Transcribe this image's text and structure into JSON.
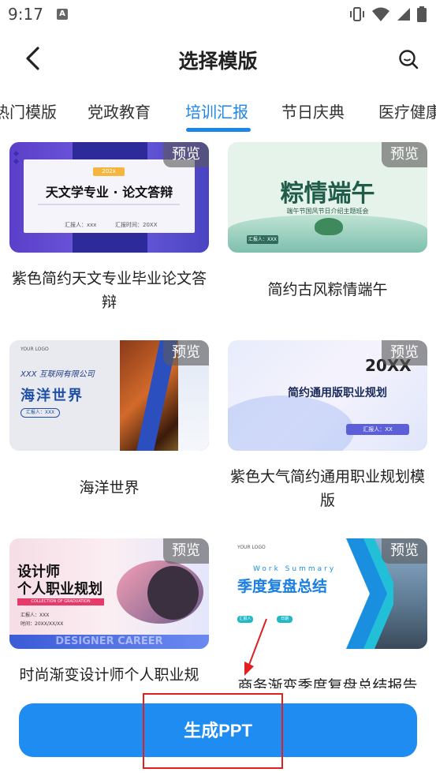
{
  "status": {
    "time": "9:17",
    "notif_letter": "A"
  },
  "header": {
    "title": "选择模版"
  },
  "tabs": [
    {
      "label": "热门模版"
    },
    {
      "label": "党政教育"
    },
    {
      "label": "培训汇报",
      "active": true
    },
    {
      "label": "节日庆典"
    },
    {
      "label": "医疗健康"
    }
  ],
  "templates": [
    {
      "name": "紫色简约天文专业毕业论文答辩",
      "thumb_title": "天文学专业 · 论文答辩",
      "thumb_tag": "202x",
      "thumb_line1": "汇报人：xxx",
      "thumb_line2": "汇报时间：20XX"
    },
    {
      "name": "简约古风粽情端午",
      "thumb_title": "粽情端午",
      "thumb_sub": "端午节国风节日介绍主题班会",
      "thumb_btn": "汇报人：XXX"
    },
    {
      "name": "海洋世界",
      "thumb_logo": "YOUR LOGO",
      "thumb_company": "XXX 互联网有限公司",
      "thumb_title": "海洋世界",
      "thumb_btn": "汇报人：XXX"
    },
    {
      "name": "紫色大气简约通用职业规划模版",
      "thumb_year": "20XX",
      "thumb_title": "简约通用版职业规划",
      "thumb_btn": "汇报人：XX"
    },
    {
      "name": "时尚渐变设计师个人职业规",
      "thumb_title_1": "设计师",
      "thumb_title_2": "个人职业规划",
      "thumb_tag": "COLLECTION OF GRADUATION",
      "thumb_line1": "汇报人：XXX",
      "thumb_line2": "时间：20XX/XX/XX",
      "thumb_bottom": "DESIGNER CAREER"
    },
    {
      "name": "商务渐变季度复盘总结报告",
      "thumb_logo": "YOUR LOGO",
      "thumb_en": "Work Summary",
      "thumb_title": "季度复盘总结",
      "thumb_btn1": "汇报人",
      "thumb_btn2": "日期"
    }
  ],
  "preview_label": "预览",
  "generate_label": "生成PPT",
  "colors": {
    "accent": "#1e86e6",
    "button": "#1e8cf0",
    "annotation": "#e02020"
  }
}
